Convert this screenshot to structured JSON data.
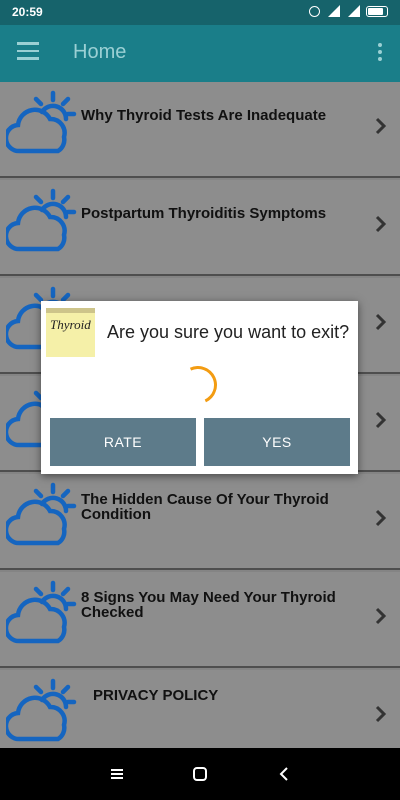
{
  "status_bar": {
    "time": "20:59"
  },
  "app_bar": {
    "title": "Home"
  },
  "list": {
    "items": [
      {
        "label": "Why Thyroid Tests Are Inadequate"
      },
      {
        "label": "Postpartum Thyroiditis Symptoms"
      },
      {
        "label": ""
      },
      {
        "label": ""
      },
      {
        "label": "The Hidden Cause Of Your Thyroid Condition"
      },
      {
        "label": "8 Signs You May Need Your Thyroid Checked"
      },
      {
        "label": "PRIVACY POLICY"
      }
    ]
  },
  "dialog": {
    "thumbnail_text": "Thyroid",
    "message": "Are you sure you want to exit?",
    "rate_label": "RATE",
    "yes_label": "YES",
    "accent_color": "#f39c12"
  },
  "colors": {
    "app_bar": "#1a7e89",
    "status_bar": "#16636b",
    "button": "#5d7b8a"
  },
  "icons": [
    "alarm-icon",
    "signal-icon",
    "battery-icon",
    "menu-icon",
    "more-icon",
    "cloud-sun-icon",
    "chevron-right-icon"
  ]
}
